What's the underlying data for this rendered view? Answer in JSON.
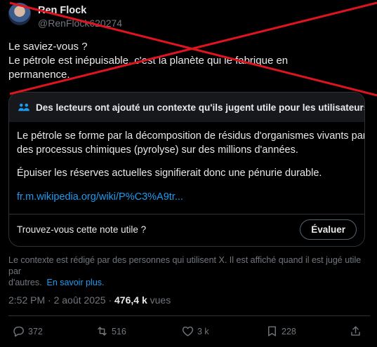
{
  "author": {
    "name": "Ren Flock",
    "handle": "@RenFlock620274"
  },
  "tweet": {
    "lines": [
      "Le saviez-vous ?",
      "Le pétrole est inépuisable, c'est la planète qui le fabrique en",
      "permanence."
    ]
  },
  "community_note": {
    "header": "Des lecteurs ont ajouté un contexte qu'ils jugent utile pour les utilisateurs.",
    "paragraph1_line1": "Le pétrole se forme par la décomposition de résidus d'organismes vivants par",
    "paragraph1_line2": "des processus chimiques (pyrolyse) sur des millions d'années.",
    "paragraph2": "Épuiser les réserves actuelles signifierait donc une pénurie durable.",
    "link": "fr.m.wikipedia.org/wiki/P%C3%A9tr...",
    "question": "Trouvez-vous cette note utile ?",
    "rate_button": "Évaluer"
  },
  "disclaimer": {
    "text_line1": "Le contexte est rédigé par des personnes qui utilisent X. Il est affiché quand il est jugé utile par",
    "text_line2": "d'autres.",
    "link": "En savoir plus."
  },
  "meta": {
    "time": "2:52 PM",
    "separator1": "·",
    "date": "2 août 2025",
    "separator2": "·",
    "views_count": "476,4 k",
    "views_label": "vues"
  },
  "actions": {
    "replies": "372",
    "reposts": "516",
    "likes": "3 k",
    "bookmarks": "228"
  },
  "colors": {
    "cross": "#e0141e",
    "link": "#1d9bf0",
    "muted": "#71767b"
  }
}
